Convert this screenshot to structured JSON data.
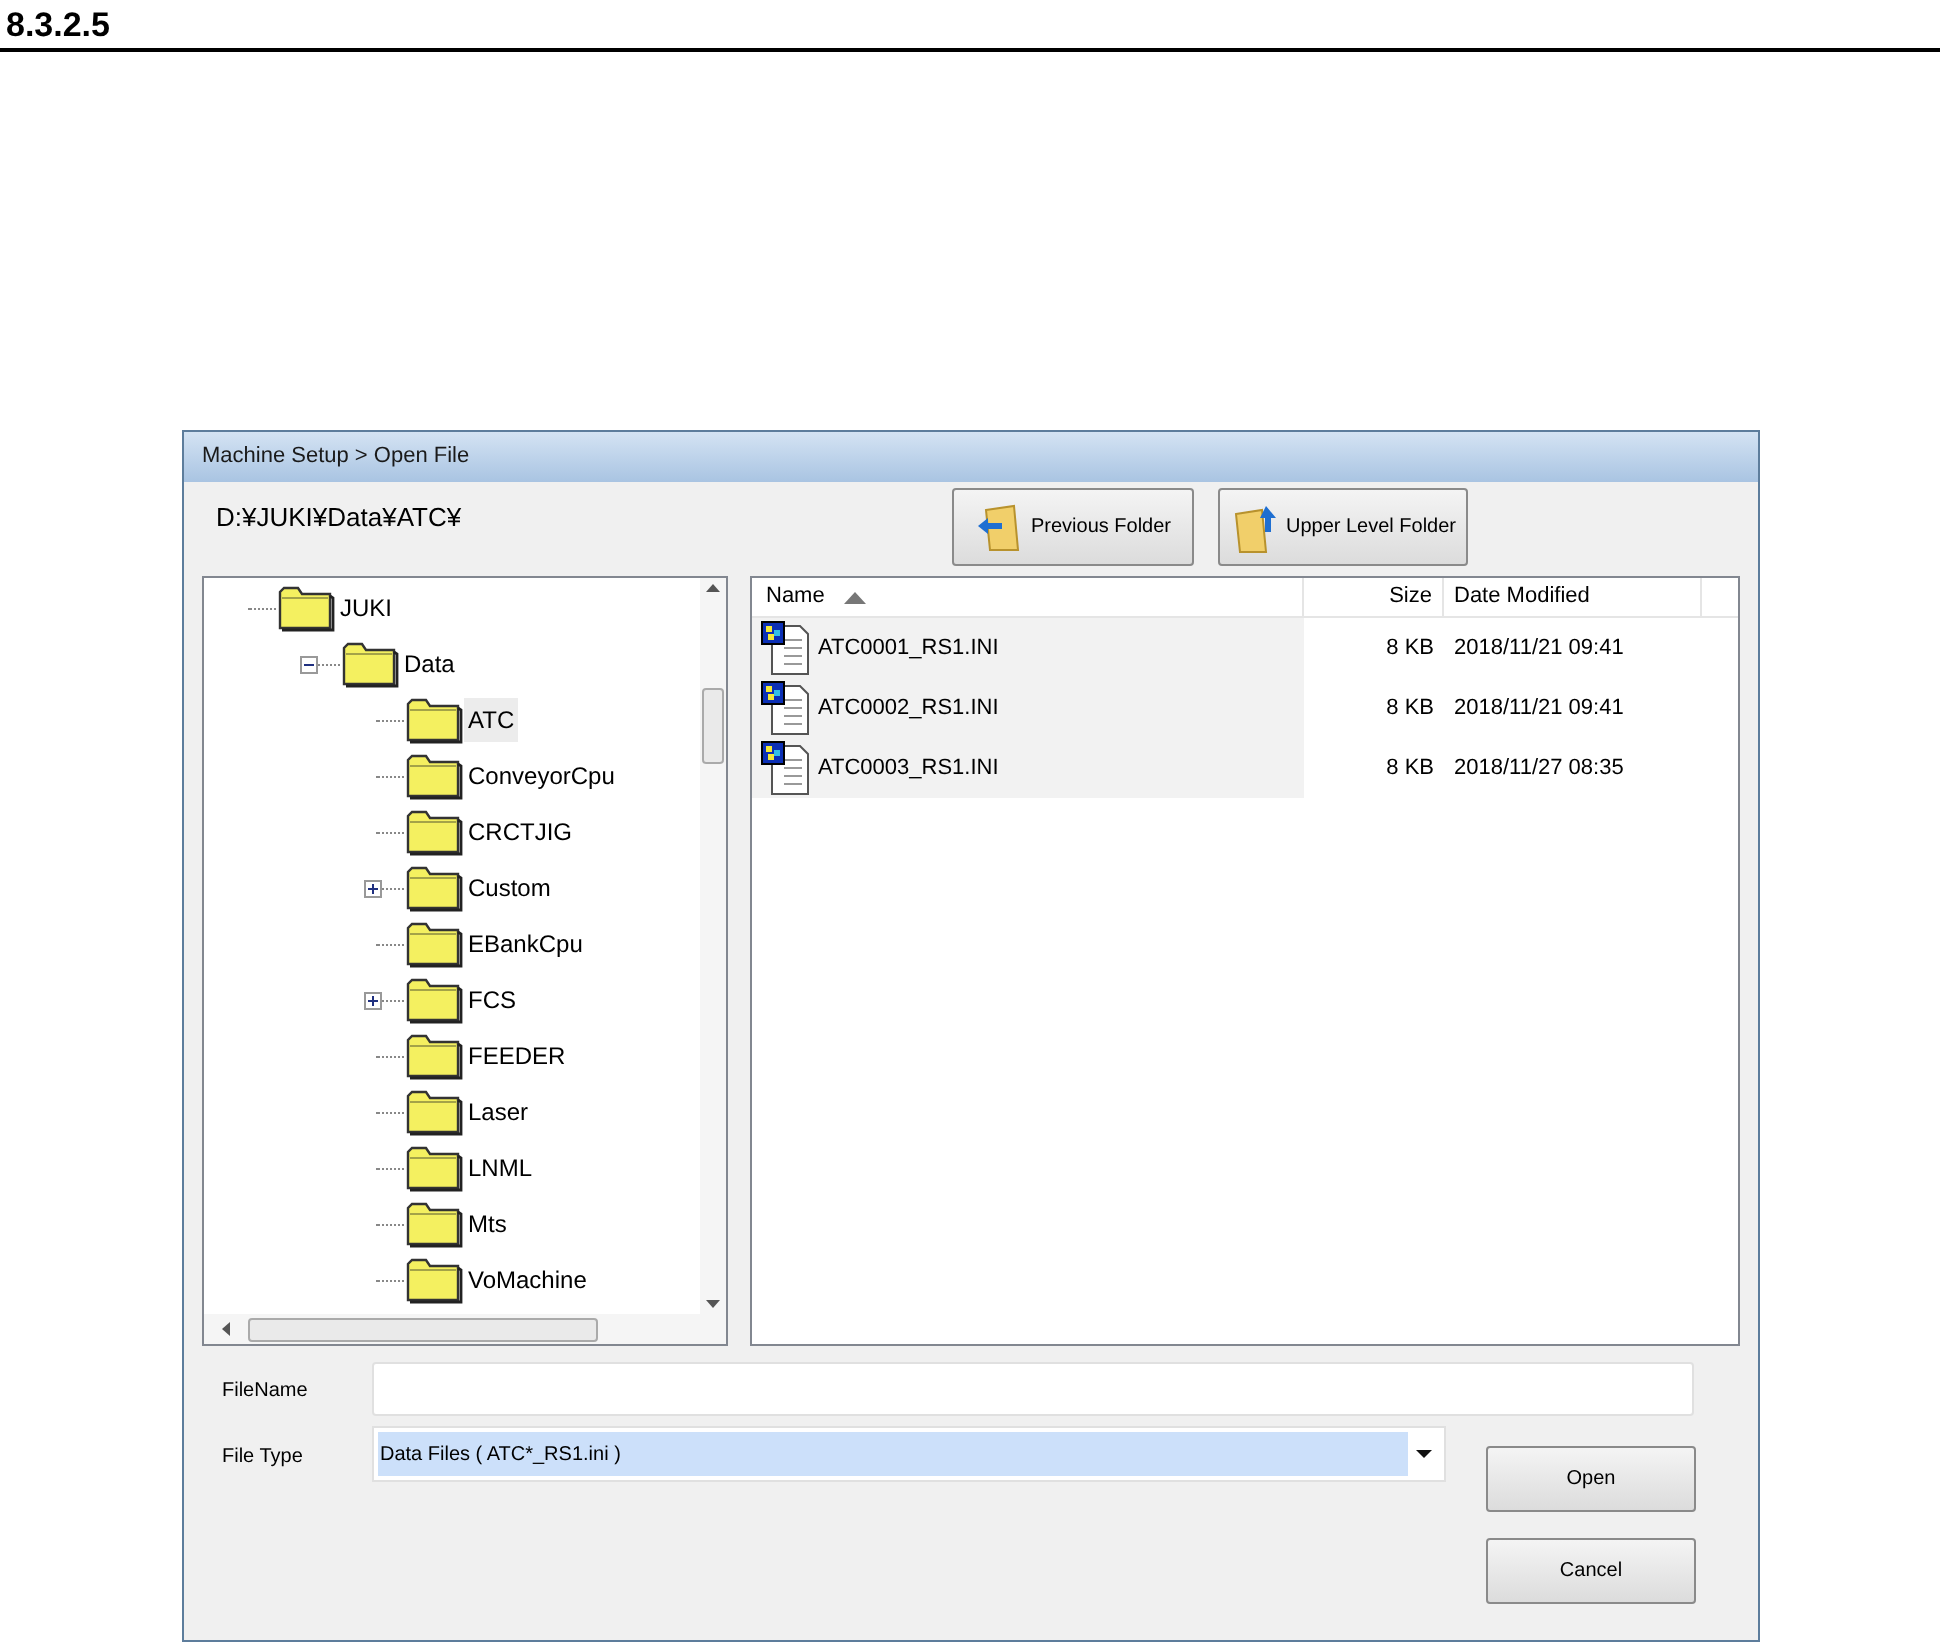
{
  "section_heading": "8.3.2.5",
  "window": {
    "title": "Machine Setup > Open File"
  },
  "current_path": "D:¥JUKI¥Data¥ATC¥",
  "toolbar_buttons": [
    {
      "label": "Previous Folder",
      "kind": "back"
    },
    {
      "label": "Upper Level Folder",
      "kind": "up"
    }
  ],
  "folder_tree": [
    {
      "label": "JUKI",
      "selected": false,
      "children": [
        {
          "label": "Data",
          "selected": false,
          "expanded": true,
          "children": [
            {
              "label": "ATC",
              "selected": true
            },
            {
              "label": "ConveyorCpu",
              "selected": false
            },
            {
              "label": "CRCTJIG",
              "selected": false
            },
            {
              "label": "Custom",
              "selected": false,
              "expanded": false
            },
            {
              "label": "EBankCpu",
              "selected": false
            },
            {
              "label": "FCS",
              "selected": false,
              "expanded": false
            },
            {
              "label": "FEEDER",
              "selected": false
            },
            {
              "label": "Laser",
              "selected": false
            },
            {
              "label": "LNML",
              "selected": false
            },
            {
              "label": "Mts",
              "selected": false
            },
            {
              "label": "VoMachine",
              "selected": false
            }
          ]
        }
      ]
    }
  ],
  "file_list": {
    "columns": [
      {
        "label": "Name",
        "sorted_ascending": true
      },
      {
        "label": "Size"
      },
      {
        "label": "Date Modified"
      }
    ],
    "rows": [
      {
        "name": "ATC0001_RS1.INI",
        "size": "8 KB",
        "date_modified": "2018/11/21 09:41"
      },
      {
        "name": "ATC0002_RS1.INI",
        "size": "8 KB",
        "date_modified": "2018/11/21 09:41"
      },
      {
        "name": "ATC0003_RS1.INI",
        "size": "8 KB",
        "date_modified": "2018/11/27 08:35"
      }
    ]
  },
  "file_name": {
    "label": "FileName"
  },
  "file_type": {
    "label": "File Type",
    "value": "Data Files ( ATC*_RS1.ini )"
  },
  "buttons": [
    "Open",
    "Cancel"
  ]
}
